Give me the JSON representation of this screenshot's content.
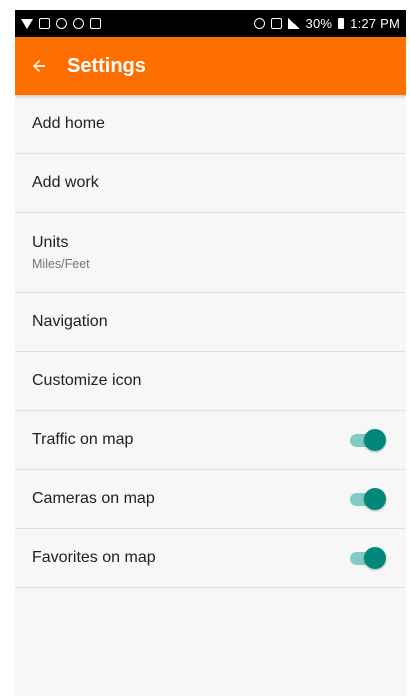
{
  "status_bar": {
    "time": "1:27 PM",
    "battery": "30%"
  },
  "app_bar": {
    "title": "Settings",
    "back_icon": "arrow-left-icon",
    "background_color": "#ff6f00"
  },
  "settings": {
    "items": [
      {
        "label": "Add home",
        "sublabel": ""
      },
      {
        "label": "Add work",
        "sublabel": ""
      },
      {
        "label": "Units",
        "sublabel": "Miles/Feet"
      },
      {
        "label": "Navigation",
        "sublabel": ""
      },
      {
        "label": "Customize icon",
        "sublabel": ""
      },
      {
        "label": "Traffic on map",
        "toggle_on": true
      },
      {
        "label": "Cameras on map",
        "toggle_on": true
      },
      {
        "label": "Favorites on map",
        "toggle_on": true
      }
    ]
  },
  "toggle_colors": {
    "thumb": "#00897b",
    "track": "#80cbc4"
  }
}
